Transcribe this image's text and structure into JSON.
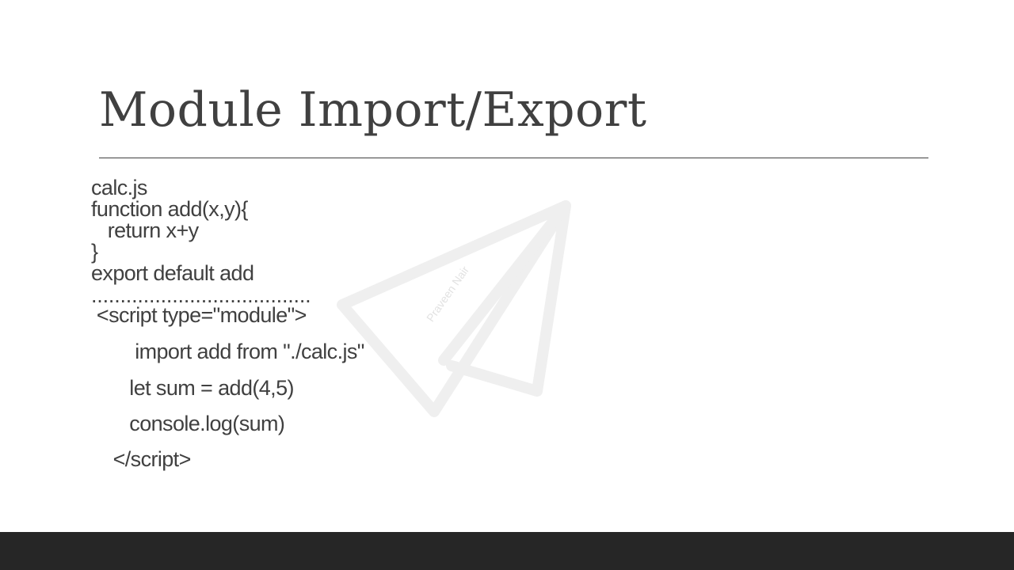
{
  "slide": {
    "title": "Module Import/Export",
    "watermark_text": "Praveen Nair",
    "code_lines": [
      "calc.js",
      "function add(x,y){",
      "   return x+y",
      "}",
      "export default add",
      "......................................",
      " <script type=\"module\">",
      "        import add from \"./calc.js\"",
      "       let sum = add(4,5)",
      "       console.log(sum)",
      "    </script>"
    ]
  },
  "colors": {
    "text": "#404040",
    "footer": "#262626",
    "watermark": "#efefef"
  }
}
